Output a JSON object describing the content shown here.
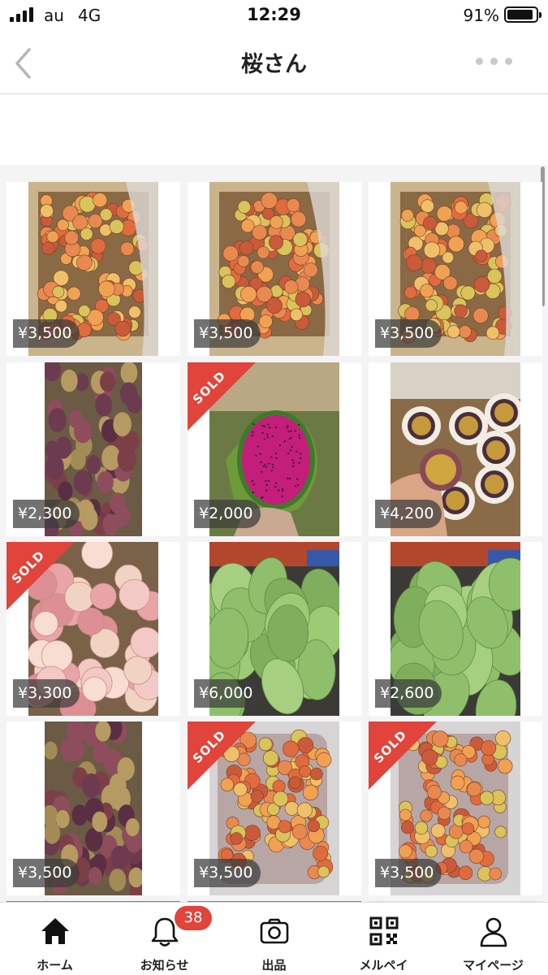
{
  "status_bar": {
    "carrier": "au",
    "network": "4G",
    "time": "12:29",
    "battery": "91%",
    "battery_fraction": 0.91
  },
  "nav": {
    "title": "桜さん",
    "back_icon": "chevron-left-icon",
    "more_icon": "more-dots-icon"
  },
  "sold_label": "SOLD",
  "products": [
    {
      "price": "¥3,500",
      "sold": false,
      "image": "lychee-in-box"
    },
    {
      "price": "¥3,500",
      "sold": false,
      "image": "lychee-in-box"
    },
    {
      "price": "¥3,500",
      "sold": false,
      "image": "lychee-in-box"
    },
    {
      "price": "¥2,300",
      "sold": false,
      "image": "plums"
    },
    {
      "price": "¥2,000",
      "sold": true,
      "image": "dragon-fruit"
    },
    {
      "price": "¥4,200",
      "sold": false,
      "image": "passion-fruit"
    },
    {
      "price": "¥3,300",
      "sold": true,
      "image": "peaches"
    },
    {
      "price": "¥6,000",
      "sold": false,
      "image": "green-mangoes"
    },
    {
      "price": "¥2,600",
      "sold": false,
      "image": "green-mangoes"
    },
    {
      "price": "¥3,500",
      "sold": false,
      "image": "plums"
    },
    {
      "price": "¥3,500",
      "sold": true,
      "image": "lychee-in-bag"
    },
    {
      "price": "¥3,500",
      "sold": true,
      "image": "lychee-in-bag"
    }
  ],
  "tabbar": {
    "items": [
      {
        "label": "ホーム",
        "icon": "home-icon"
      },
      {
        "label": "お知らせ",
        "icon": "bell-icon",
        "badge": "38"
      },
      {
        "label": "出品",
        "icon": "camera-icon"
      },
      {
        "label": "メルペイ",
        "icon": "qr-code-icon"
      },
      {
        "label": "マイページ",
        "icon": "person-icon"
      }
    ]
  },
  "colors": {
    "sold_ribbon": "#e0443a",
    "badge": "#e0443a",
    "grid_background": "#f4f4f6"
  }
}
